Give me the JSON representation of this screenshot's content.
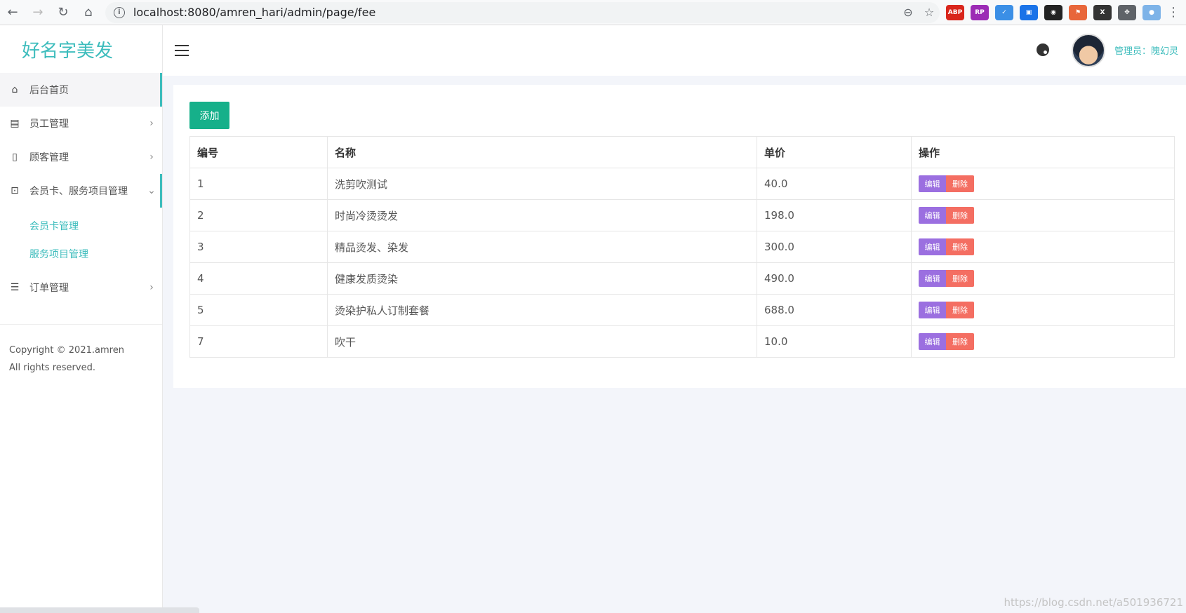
{
  "browser": {
    "url": "localhost:8080/amren_hari/admin/page/fee",
    "extensions": [
      {
        "name": "abp-icon",
        "label": "ABP",
        "color": "#d9261c"
      },
      {
        "name": "rp-icon",
        "label": "RP",
        "color": "#9c2bb5"
      },
      {
        "name": "check-icon",
        "label": "✓",
        "color": "#3b8fe6"
      },
      {
        "name": "doc-lock-icon",
        "label": "▣",
        "color": "#1a73e8"
      },
      {
        "name": "mask-icon",
        "label": "◉",
        "color": "#222222"
      },
      {
        "name": "sitemap-icon",
        "label": "⚑",
        "color": "#e8663a"
      },
      {
        "name": "x-box-icon",
        "label": "X",
        "color": "#333333"
      },
      {
        "name": "puzzle-icon",
        "label": "✥",
        "color": "#5f6368"
      },
      {
        "name": "profile-icon",
        "label": "●",
        "color": "#7db3e8"
      }
    ]
  },
  "brand": "好名字美发",
  "sidebar": {
    "items": [
      {
        "label": "后台首页",
        "icon": "home-icon",
        "glyph": "⌂"
      },
      {
        "label": "员工管理",
        "icon": "staff-icon",
        "glyph": "▤"
      },
      {
        "label": "顾客管理",
        "icon": "file-icon",
        "glyph": "▯"
      },
      {
        "label": "会员卡、服务项目管理",
        "icon": "sitemap-icon",
        "glyph": "⊡"
      },
      {
        "label": "订单管理",
        "icon": "indent-icon",
        "glyph": "☰"
      }
    ],
    "submenu": [
      "会员卡管理",
      "服务项目管理"
    ],
    "copyright": "Copyright © 2021.amren All rights reserved."
  },
  "header": {
    "admin_label": "管理员：隗幻灵"
  },
  "main": {
    "add_label": "添加",
    "columns": [
      "编号",
      "名称",
      "单价",
      "操作"
    ],
    "rows": [
      {
        "id": "1",
        "name": "洗剪吹测试",
        "price": "40.0"
      },
      {
        "id": "2",
        "name": "时尚冷烫烫发",
        "price": "198.0"
      },
      {
        "id": "3",
        "name": "精品烫发、染发",
        "price": "300.0"
      },
      {
        "id": "4",
        "name": "健康发质烫染",
        "price": "490.0"
      },
      {
        "id": "5",
        "name": "烫染护私人订制套餐",
        "price": "688.0"
      },
      {
        "id": "7",
        "name": "吹干",
        "price": "10.0"
      }
    ],
    "edit_label": "编辑",
    "delete_label": "删除"
  },
  "watermark": "https://blog.csdn.net/a501936721"
}
